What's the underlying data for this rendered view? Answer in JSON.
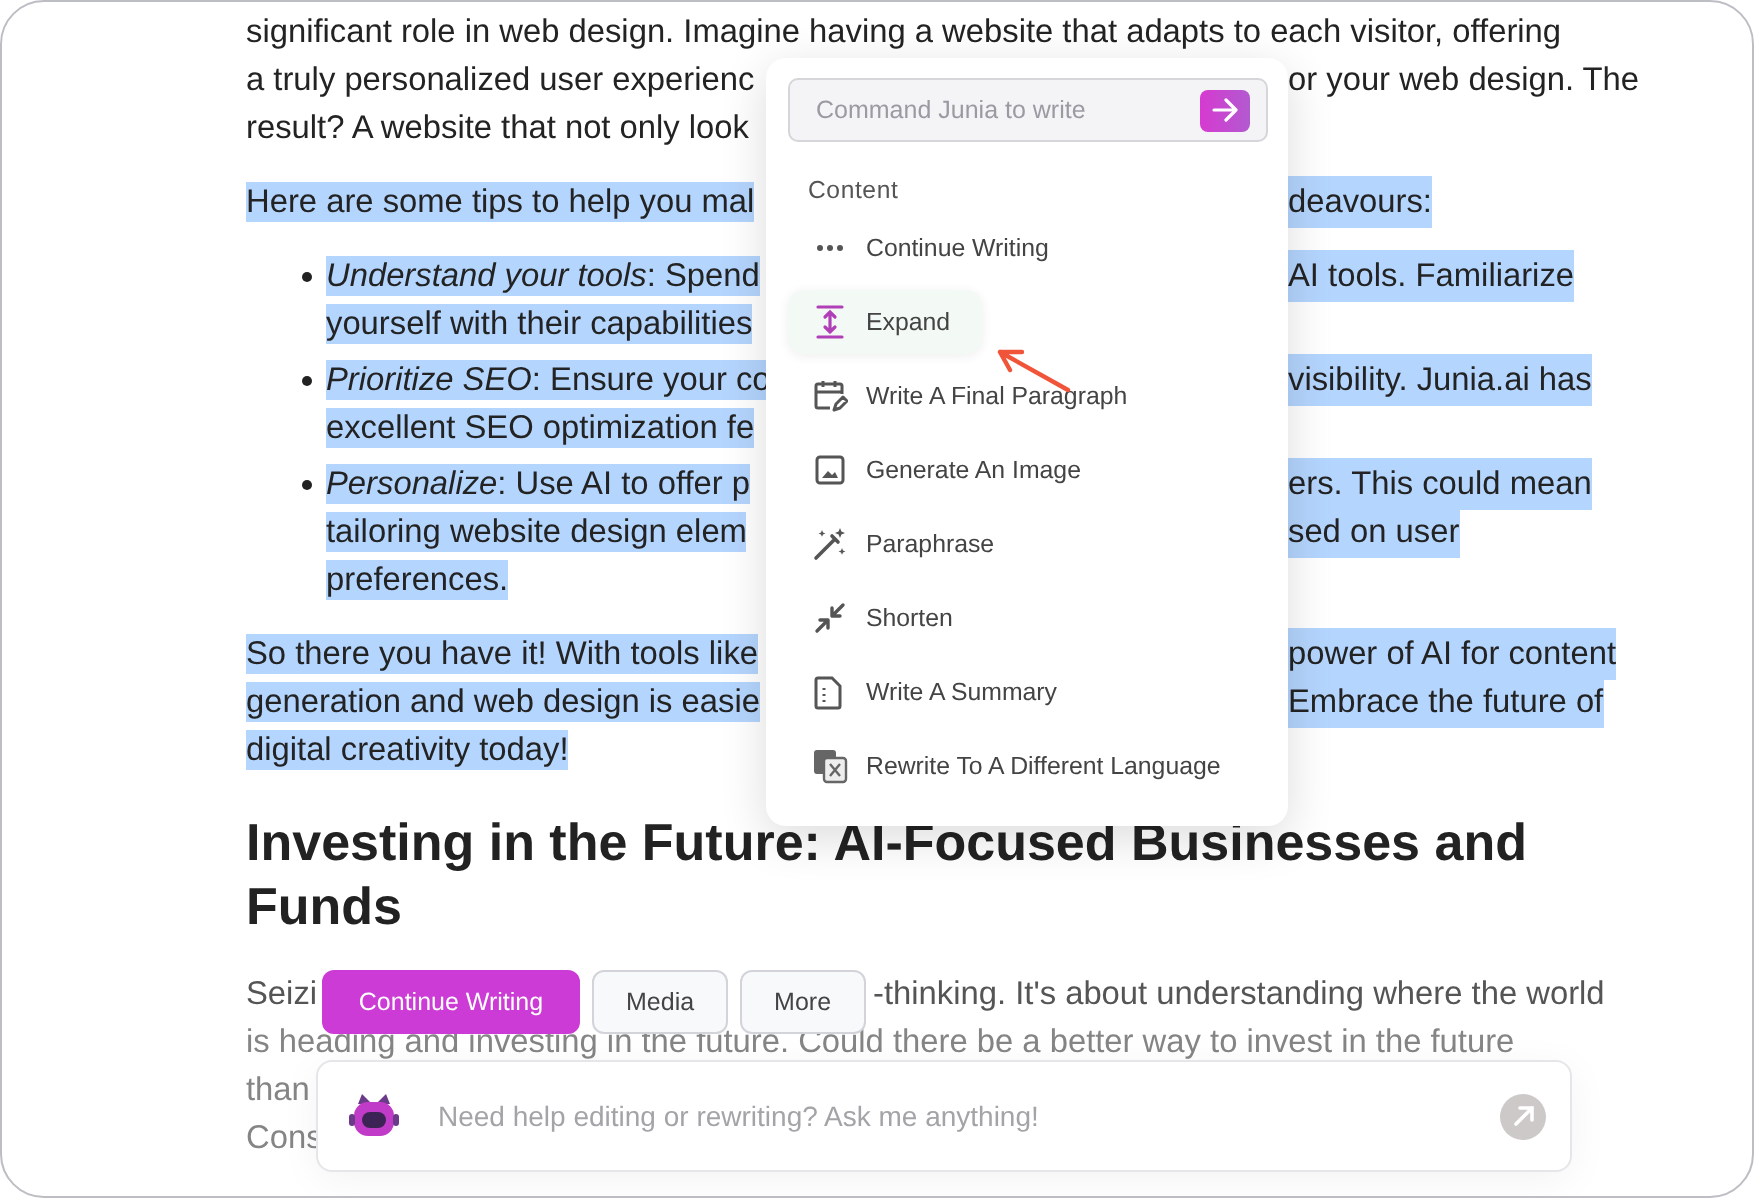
{
  "document": [
    {
      "kind": "paragraph",
      "highlighted": false,
      "lines": [
        {
          "left": "significant role in web design. Imagine having a website that adapts to each visitor, offering"
        },
        {
          "left": "a truly personalized user experienc",
          "right": "or your web design. The"
        },
        {
          "left": "result? A website that not only look"
        }
      ]
    },
    {
      "kind": "paragraph",
      "highlighted": true,
      "lines": [
        {
          "left": "Here are some tips to help you mal",
          "right": "deavours:"
        }
      ]
    },
    {
      "kind": "list",
      "items": [
        {
          "highlighted": true,
          "lines": [
            {
              "left": "*Understand your tools*: Spend",
              "right": "AI tools. Familiarize"
            },
            {
              "left": "yourself with their capabilities"
            }
          ]
        },
        {
          "highlighted": true,
          "lines": [
            {
              "left": "*Prioritize SEO*: Ensure your co",
              "right": "visibility. Junia.ai has"
            },
            {
              "left": "excellent SEO optimization fe"
            }
          ]
        },
        {
          "highlighted": true,
          "lines": [
            {
              "left": "*Personalize*: Use AI to offer p",
              "right": "ers. This could mean"
            },
            {
              "left": "tailoring website design elem",
              "right": "sed on user"
            },
            {
              "left": "preferences."
            }
          ]
        }
      ]
    },
    {
      "kind": "paragraph",
      "highlighted": true,
      "lines": [
        {
          "left": "So there you have it! With tools like",
          "right": "power of AI for content"
        },
        {
          "left": "generation and web design is easie",
          "right": "Embrace the future of"
        },
        {
          "left": "digital creativity today!"
        }
      ]
    },
    {
      "kind": "heading",
      "text": "Investing in the Future: AI-Focused Businesses and Funds"
    },
    {
      "kind": "covered",
      "lines": [
        {
          "left": "Seizi",
          "right": "-thinking. It's about understanding where the world"
        },
        {
          "left": "is heading and investing in the future. Could there be a better way to invest in the future"
        },
        {
          "left": "than"
        },
        {
          "left": "Cons"
        }
      ]
    }
  ],
  "command_menu": {
    "placeholder": "Command Junia to write",
    "section": "Content",
    "items": [
      {
        "label": "Continue Writing",
        "selected": false
      },
      {
        "label": "Expand",
        "selected": true
      },
      {
        "label": "Write A Final Paragraph",
        "selected": false
      },
      {
        "label": "Generate An Image",
        "selected": false
      },
      {
        "label": "Paraphrase",
        "selected": false
      },
      {
        "label": "Shorten",
        "selected": false
      },
      {
        "label": "Write A Summary",
        "selected": false
      },
      {
        "label": "Rewrite To A Different Language",
        "selected": false
      }
    ]
  },
  "toolbar": [
    {
      "label": "Continue Writing",
      "selected": true
    },
    {
      "label": "Media",
      "selected": false
    },
    {
      "label": "More",
      "selected": false
    }
  ],
  "chat": {
    "placeholder": "Need help editing or rewriting? Ask me anything!"
  }
}
